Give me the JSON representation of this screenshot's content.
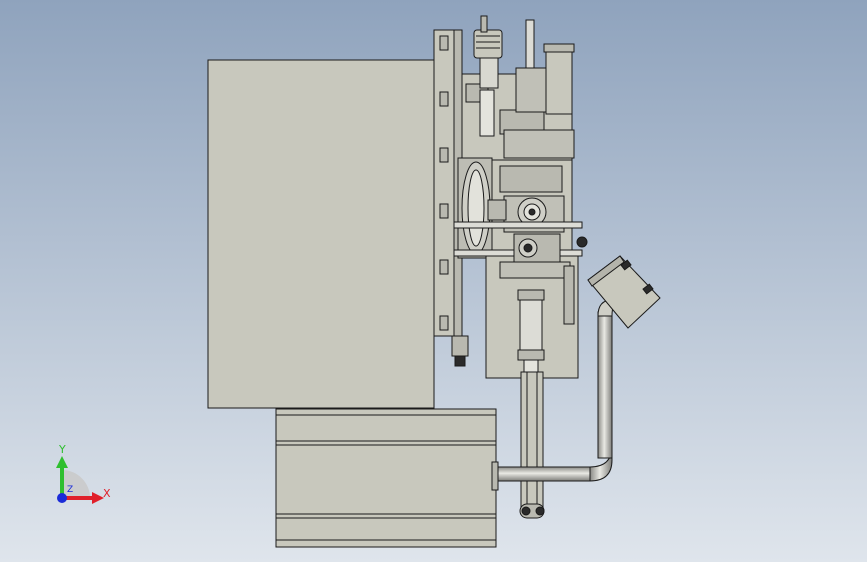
{
  "viewport": {
    "background_top": "#8fa3bd",
    "background_bottom": "#dfe5ec"
  },
  "model": {
    "body_fill": "#c8c8bd",
    "edge": "#1a1a1a",
    "detail_fill": "#b9b9b0",
    "dark_fill": "#2a2a2a"
  },
  "triad": {
    "x_label": "X",
    "y_label": "Y",
    "z_label": "Z",
    "x_color": "#e0202a",
    "y_color": "#2fbf2f",
    "z_color": "#1a2bd8"
  }
}
